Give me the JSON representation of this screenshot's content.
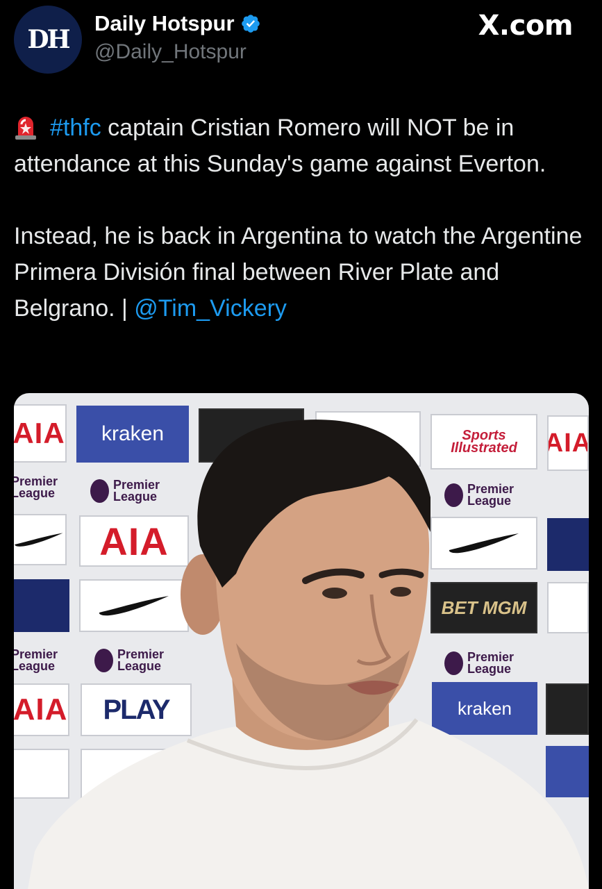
{
  "header": {
    "avatar_initials": "DH",
    "display_name": "Daily Hotspur",
    "handle": "@Daily_Hotspur",
    "source_label": "X.com",
    "verified_icon": "verified-badge-icon",
    "colors": {
      "verified": "#1d9bf0",
      "link": "#1d9bf0",
      "handle": "#71767b"
    }
  },
  "tweet": {
    "siren_icon": "siren-emoji-icon",
    "hashtag": "#thfc",
    "line1_rest": " captain Cristian Romero will NOT be in attendance at this Sunday's game against Everton.",
    "para2": "Instead, he is back in Argentina to watch the Argentine Primera División final between River Plate and Belgrano. | ",
    "mention": "@Tim_Vickery"
  },
  "media": {
    "alt": "Interview photo",
    "sponsor_board": {
      "aia": "AIA",
      "kraken": "kraken",
      "premier_league": "Premier League",
      "sports_illustrated": "Sports Illustrated",
      "betmgm": "BET MGM",
      "play": "PLAY"
    }
  }
}
